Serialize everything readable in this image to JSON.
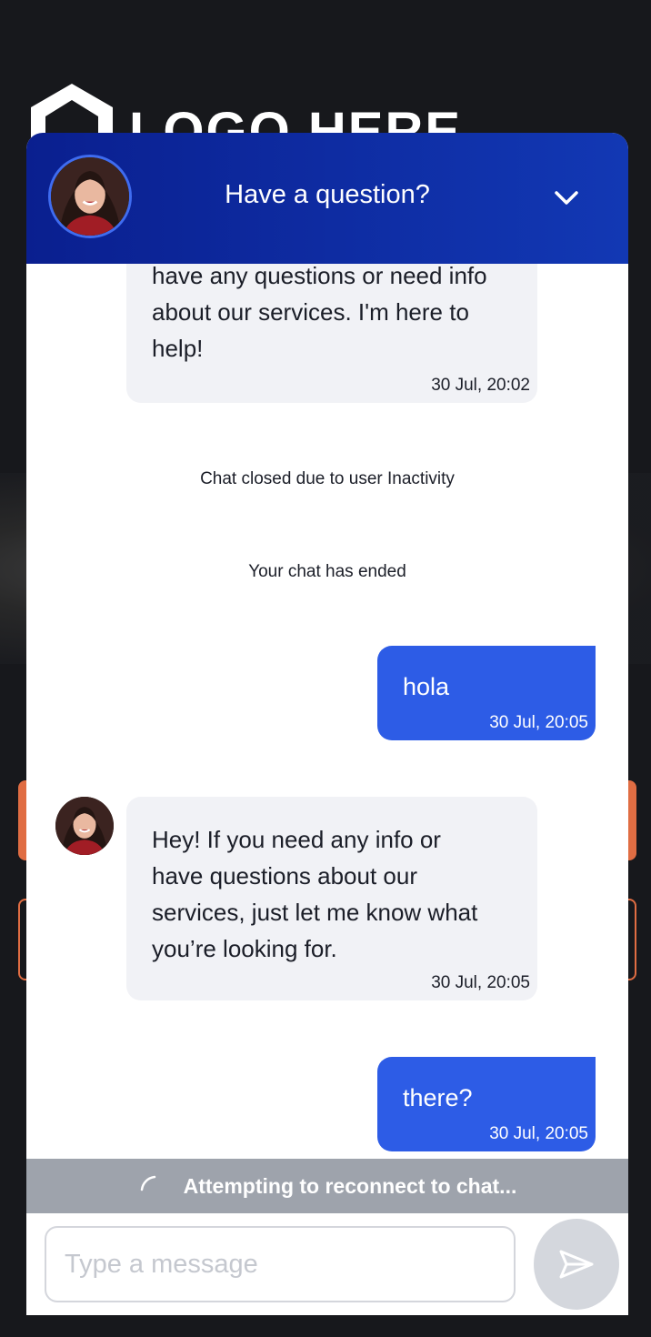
{
  "background": {
    "logo_text": "LOGO HERE",
    "accent_color": "#e06d43"
  },
  "header": {
    "title": "Have a question?",
    "avatar_icon": "agent-avatar",
    "collapse_icon": "chevron-down-icon",
    "gradient": [
      "#0a1f8f",
      "#1238b4"
    ]
  },
  "messages": {
    "bot_first": {
      "lines": [
        "have any questions or need info",
        "about our services. I'm here to",
        "help!"
      ],
      "time": "30 Jul, 20:02"
    },
    "system_closed": "Chat closed due to user Inactivity",
    "system_ended": "Your chat has ended",
    "user_first": {
      "text": "hola",
      "time": "30 Jul, 20:05"
    },
    "bot_second": {
      "lines": [
        "Hey! If you need any info or",
        "have questions about our",
        "services, just let me know what",
        "you’re looking for."
      ],
      "time": "30 Jul, 20:05"
    },
    "user_second": {
      "text": "there?",
      "time": "30 Jul, 20:05"
    }
  },
  "status": {
    "reconnect_text": "Attempting to reconnect to chat...",
    "spinner_icon": "spinner-icon"
  },
  "composer": {
    "placeholder": "Type a message",
    "value": "",
    "send_icon": "send-icon"
  },
  "colors": {
    "user_bubble": "#2d5ce6",
    "bot_bubble": "#f1f2f6",
    "status_bar": "#9ea3ac",
    "send_button": "#d4d7dd"
  }
}
